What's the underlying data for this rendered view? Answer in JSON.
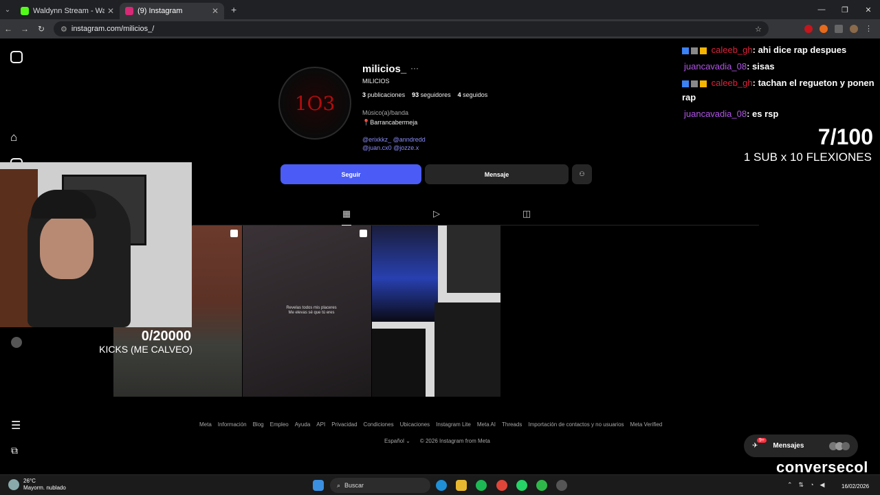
{
  "browser": {
    "tabs": [
      {
        "label": "Waldynn Stream - Watch Live o",
        "active": false,
        "favicon_color": "#53fc18"
      },
      {
        "label": "(9) Instagram",
        "active": true,
        "favicon_color": "#d62976"
      }
    ],
    "new_tab": "+",
    "url": "instagram.com/milicios_/"
  },
  "profile": {
    "username": "milicios_",
    "more": "···",
    "full_name": "MILICIOS",
    "posts_count": "3",
    "posts_label": "publicaciones",
    "followers_count": "93",
    "followers_label": "seguidores",
    "following_count": "4",
    "following_label": "seguidos",
    "category": "Músico(a)/banda",
    "location": "📍Barrancabermeja",
    "mentions_line1": "@erixkkz_ @anndredd",
    "mentions_line2": "@juan.cx0 @jozze.x",
    "avatar_text": "1O3",
    "follow_button": "Seguir",
    "message_button": "Mensaje"
  },
  "posts": {
    "post2_text_line1": "Revelas todos mis placeres",
    "post2_text_line2": "Me elevas sé que tú eres"
  },
  "footer": {
    "links": [
      "Meta",
      "Información",
      "Blog",
      "Empleo",
      "Ayuda",
      "API",
      "Privacidad",
      "Condiciones",
      "Ubicaciones",
      "Instagram Lite",
      "Meta AI",
      "Threads",
      "Importación de contactos y no usuarios",
      "Meta Verified"
    ],
    "language": "Español",
    "copyright": "© 2026 Instagram from Meta"
  },
  "stream_overlay": {
    "kicks_count": "0/20000",
    "kicks_label": "KICKS (ME CALVEO)",
    "goal_count": "7/100",
    "goal_label": "1 SUB x 10 FLEXIONES",
    "brand": "conversecol"
  },
  "chat": [
    {
      "user": "caleeb_gh",
      "color": "#e0223a",
      "badges": true,
      "message": ": ahi dice rap despues"
    },
    {
      "user": "juancavadia_08",
      "color": "#b256e8",
      "badges": false,
      "message": ": sisas"
    },
    {
      "user": "caleeb_gh",
      "color": "#e0223a",
      "badges": true,
      "message": ": tachan el regueton y ponen rap"
    },
    {
      "user": "juancavadia_08",
      "color": "#b256e8",
      "badges": false,
      "message": ": es rsp"
    }
  ],
  "messages_widget": {
    "label": "Mensajes",
    "badge": "9+"
  },
  "taskbar": {
    "temperature": "26°C",
    "weather": "Mayorm. nublado",
    "search_label": "Buscar",
    "date": "16/02/2026"
  }
}
